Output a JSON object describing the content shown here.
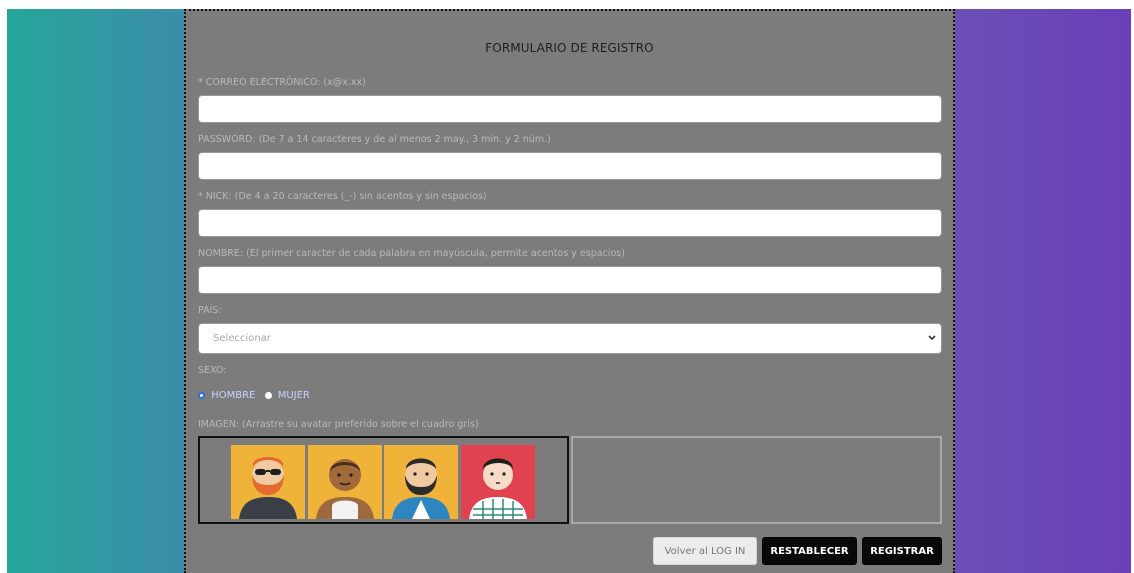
{
  "form": {
    "title": "FORMULARIO DE REGISTRO",
    "fields": {
      "email_label": "* CORREO ELECTRÓNICO: (x@x.xx)",
      "password_label": "PASSWORD: (De 7 a 14 caracteres y de al menos 2 may., 3 min. y 2 núm.)",
      "nick_label": "* NICK: (De 4 a 20 caracteres (_-) sin acentos y sin espacios)",
      "nombre_label": "NOMBRE: (El primer caracter de cada palabra en mayúscula, permite acentos y espacios)",
      "pais_label": "PAÍS:",
      "pais_value": "Seleccionar",
      "sexo_label": "SEXO:",
      "radio_hombre": "HOMBRE",
      "radio_mujer": "MUJER",
      "imagen_label": "IMAGEN: (Arrastre su avatar preferido sobre el cuadro gris)"
    },
    "avatars": [
      {
        "name": "bearded-sunglasses-avatar",
        "bg": "#f0b33a"
      },
      {
        "name": "tank-top-avatar",
        "bg": "#f0b33a"
      },
      {
        "name": "beard-avatar",
        "bg": "#f0b33a"
      },
      {
        "name": "plaid-shirt-avatar",
        "bg": "#e0434f"
      }
    ],
    "buttons": {
      "volver": "Volver al LOG IN",
      "restablecer": "RESTABLECER",
      "registrar": "REGISTRAR"
    }
  },
  "colors": {
    "gradient_left": "#26a69a",
    "gradient_right": "#6a3fb8",
    "form_bg": "#7c7c7c",
    "radio_selected": "#2b6de4"
  }
}
